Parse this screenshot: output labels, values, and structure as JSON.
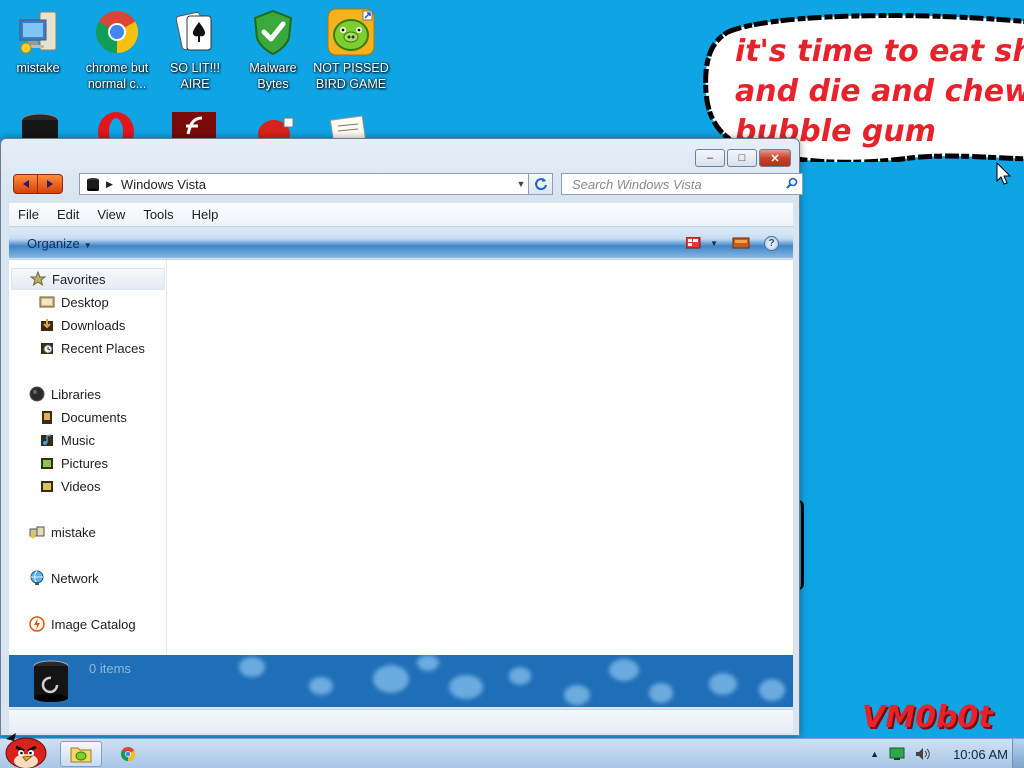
{
  "desktop": {
    "icons_row1": [
      {
        "label": "mistake",
        "icon": "computer-icon"
      },
      {
        "label": "chrome but normal c...",
        "icon": "chrome-icon"
      },
      {
        "label": "SO LIT!!! AIRE",
        "icon": "solitaire-icon"
      },
      {
        "label": "Malware Bytes",
        "icon": "shield-icon"
      },
      {
        "label": "NOT PISSED BIRD GAME",
        "icon": "pig-icon"
      }
    ],
    "icons_row2": [
      {
        "icon": "recycle-bin-icon"
      },
      {
        "icon": "opera-icon"
      },
      {
        "icon": "flash-icon"
      },
      {
        "icon": "angry-bird-icon"
      },
      {
        "icon": "document-icon"
      }
    ],
    "bubble_text": "it's time to eat shit\nand die and chew\nbubble gum",
    "signature_text": "VM0b0t"
  },
  "window": {
    "title_buttons": {
      "minimize": "–",
      "maximize": "□",
      "close": "✕"
    },
    "address": {
      "path": "Windows Vista"
    },
    "search": {
      "placeholder": "Search Windows Vista"
    },
    "menu": [
      "File",
      "Edit",
      "View",
      "Tools",
      "Help"
    ],
    "toolbar": {
      "organize": "Organize",
      "help": "?"
    },
    "nav": {
      "favorites": "Favorites",
      "desktop": "Desktop",
      "downloads": "Downloads",
      "recent_places": "Recent Places",
      "libraries": "Libraries",
      "documents": "Documents",
      "music": "Music",
      "pictures": "Pictures",
      "videos": "Videos",
      "mistake": "mistake",
      "network": "Network",
      "image_catalog": "Image Catalog"
    },
    "details": {
      "count": "0 items"
    }
  },
  "taskbar": {
    "clock": "10:06 AM"
  },
  "colors": {
    "desktop_bg": "#0fa4e4",
    "bubble_text": "#e8222a",
    "details_bg": "#1f6fb8"
  }
}
